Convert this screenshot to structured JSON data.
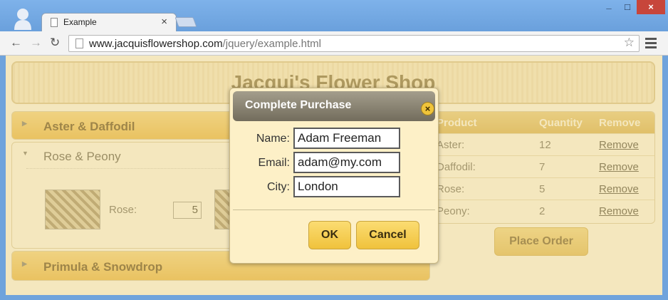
{
  "browser": {
    "tab_title": "Example",
    "tab_close": "×",
    "url_host": "www.jacquisflowershop.com",
    "url_path": "/jquery/example.html",
    "window_buttons": {
      "minimize": "_",
      "maximize": "□",
      "close": "×"
    },
    "nav": {
      "back": "←",
      "forward": "→",
      "reload": "↻",
      "star": "☆"
    }
  },
  "page": {
    "heading": "Jacqui's Flower Shop",
    "accordion": [
      {
        "label": "Aster & Daffodil",
        "arrow": "▶"
      },
      {
        "label": "Rose & Peony",
        "arrow": "▼"
      },
      {
        "label": "Primula & Snowdrop",
        "arrow": "▶"
      }
    ],
    "flower_item": {
      "label": "Rose:",
      "quantity": "5"
    },
    "summary": {
      "headers": [
        "Product",
        "Quantity",
        "Remove"
      ],
      "rows": [
        {
          "product": "Aster:",
          "quantity": "12",
          "action": "Remove"
        },
        {
          "product": "Daffodil:",
          "quantity": "7",
          "action": "Remove"
        },
        {
          "product": "Rose:",
          "quantity": "5",
          "action": "Remove"
        },
        {
          "product": "Peony:",
          "quantity": "2",
          "action": "Remove"
        }
      ]
    },
    "place_order": "Place Order"
  },
  "dialog": {
    "title": "Complete Purchase",
    "close": "×",
    "fields": [
      {
        "label": "Name:",
        "value": "Adam Freeman"
      },
      {
        "label": "Email:",
        "value": "adam@my.com"
      },
      {
        "label": "City:",
        "value": "London"
      }
    ],
    "ok": "OK",
    "cancel": "Cancel"
  }
}
